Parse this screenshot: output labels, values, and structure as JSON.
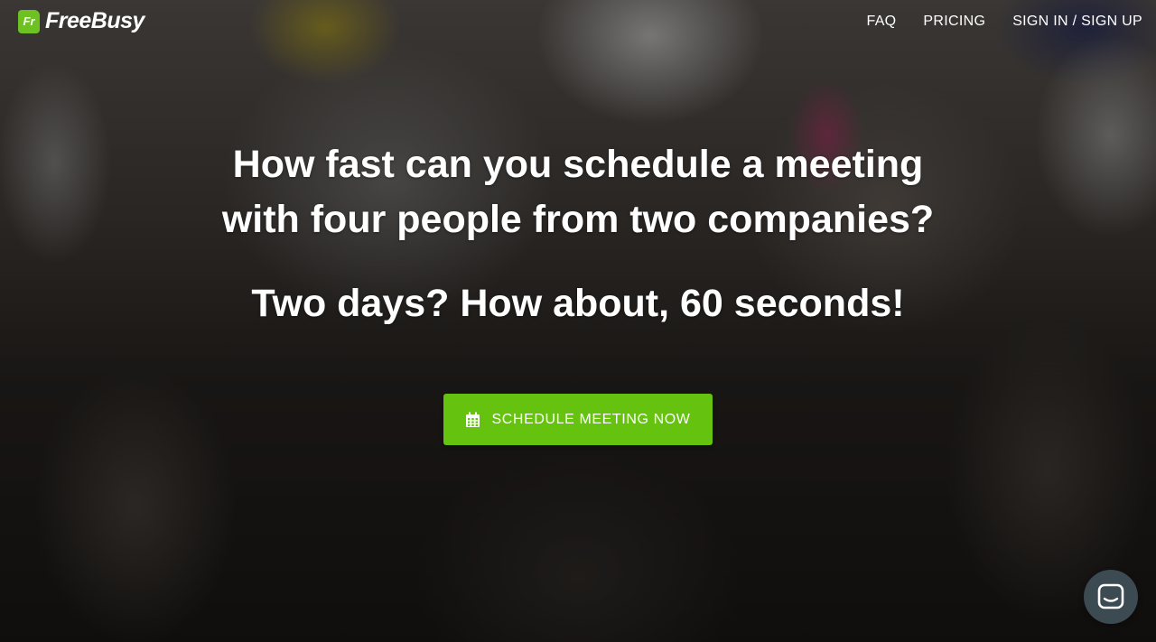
{
  "brand": {
    "logo_mark": "Fr",
    "name": "FreeBusy",
    "accent_color": "#65c20f"
  },
  "nav": {
    "items": [
      {
        "label": "FAQ"
      },
      {
        "label": "PRICING"
      },
      {
        "label": "SIGN IN / SIGN UP"
      }
    ]
  },
  "hero": {
    "headline_line1": "How fast can you schedule a meeting",
    "headline_line2": "with four people from two companies?",
    "subheadline": "Two days? How about, 60 seconds!",
    "cta_label": "SCHEDULE MEETING NOW",
    "cta_icon": "calendar-icon"
  },
  "chat_widget": {
    "icon": "chat-icon"
  }
}
